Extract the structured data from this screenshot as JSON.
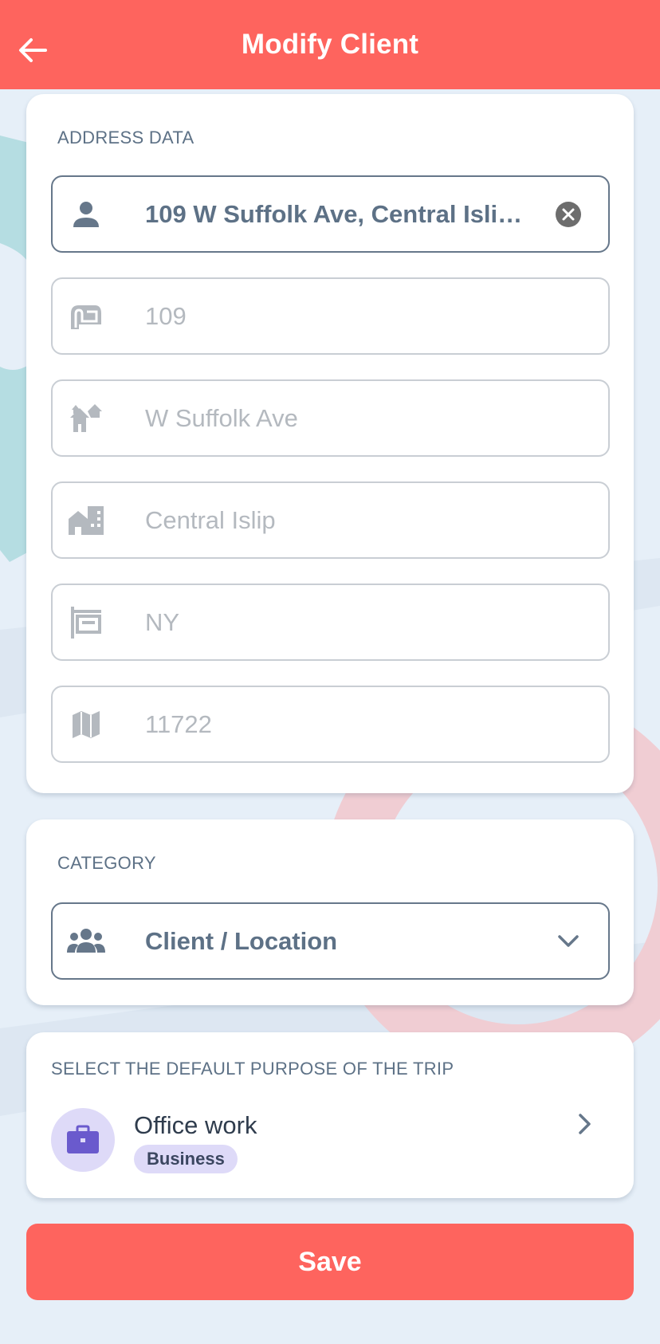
{
  "header": {
    "title": "Modify Client",
    "back_icon": "arrow-left-icon"
  },
  "address": {
    "section_label": "ADDRESS DATA",
    "search_value": "109 W Suffolk Ave, Central Islip, NY...",
    "house_number": "109",
    "street": "W Suffolk Ave",
    "city": "Central Islip",
    "state": "NY",
    "zip": "11722"
  },
  "category": {
    "section_label": "CATEGORY",
    "selected": "Client / Location"
  },
  "purpose": {
    "section_label": "SELECT THE DEFAULT PURPOSE OF THE TRIP",
    "title": "Office work",
    "badge": "Business"
  },
  "actions": {
    "save_label": "Save"
  },
  "colors": {
    "accent": "#fe645e",
    "label": "#5d7186",
    "purpose_bg": "#dedaf8",
    "purpose_icon": "#6a5acd"
  }
}
